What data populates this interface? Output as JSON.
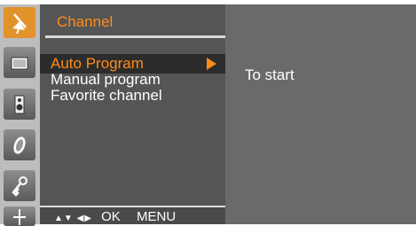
{
  "menu": {
    "title": "Channel",
    "items": [
      {
        "label": "Auto Program",
        "selected": true
      },
      {
        "label": "Manual program",
        "selected": false
      },
      {
        "label": "Favorite channel",
        "selected": false
      }
    ]
  },
  "icons": [
    {
      "name": "antenna-icon",
      "selected": true
    },
    {
      "name": "picture-icon",
      "selected": false
    },
    {
      "name": "speaker-icon",
      "selected": false
    },
    {
      "name": "clock-icon",
      "selected": false
    },
    {
      "name": "key-icon",
      "selected": false
    },
    {
      "name": "input-icon",
      "selected": false
    }
  ],
  "footer": {
    "nav_symbols": "▲▼ ◀▶",
    "ok": "OK",
    "menu": "MENU"
  },
  "panel": {
    "hint": "To start"
  },
  "colors": {
    "accent": "#ff8c1a",
    "selected_icon": "#e2922a",
    "menu_bg": "#555555",
    "panel_bg": "#6a6a6a"
  }
}
